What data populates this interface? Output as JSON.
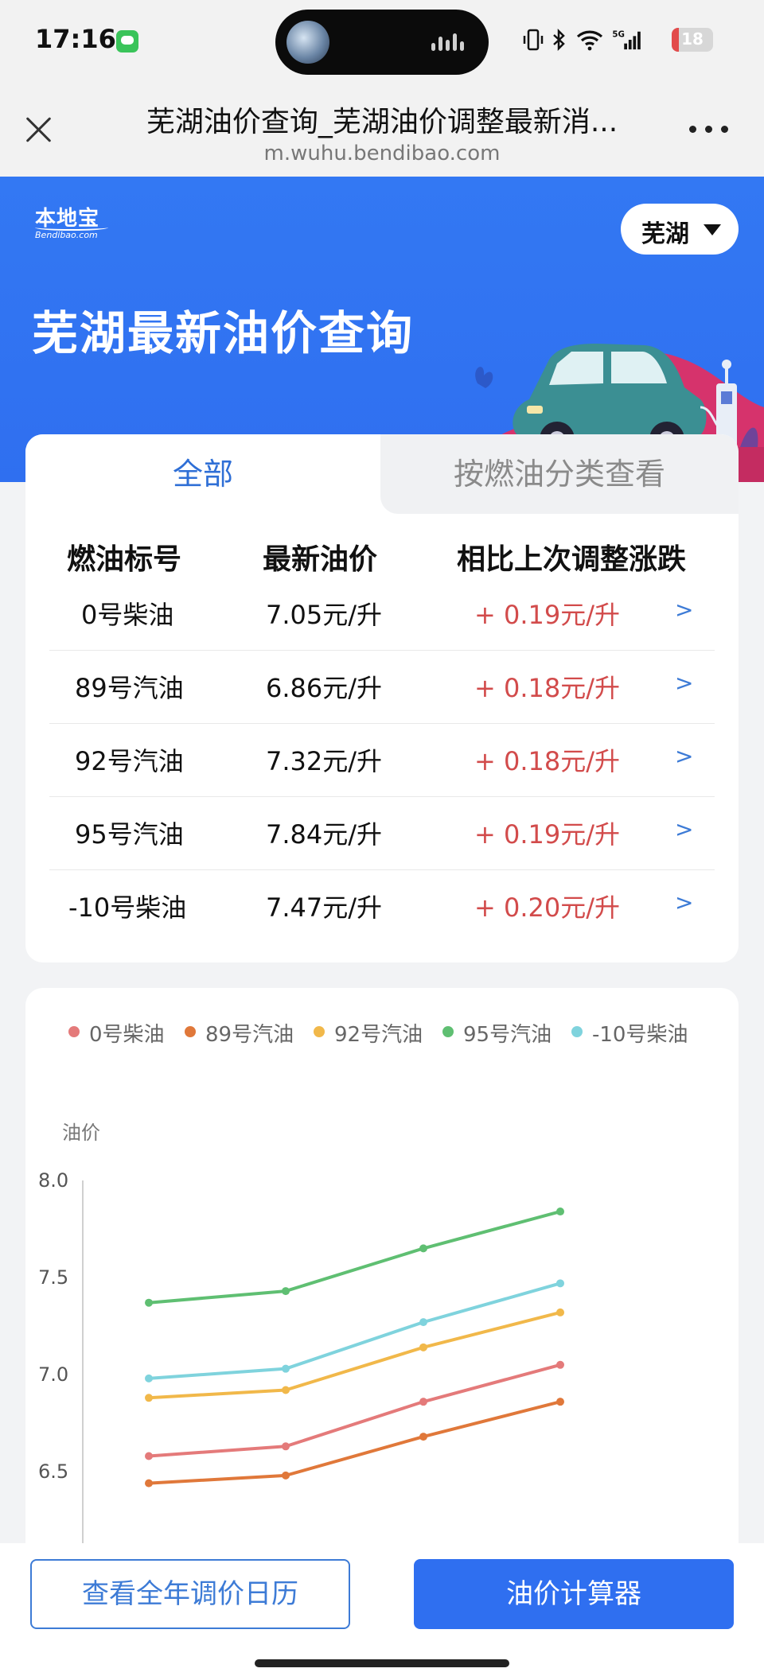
{
  "status_bar": {
    "time": "17:16",
    "battery": "18",
    "battery_level": 0.18,
    "icons": [
      "message-icon",
      "vibrate-icon",
      "bluetooth-icon",
      "wifi-icon",
      "5g-signal-icon",
      "battery-icon"
    ]
  },
  "browser": {
    "title": "芜湖油价查询_芜湖油价调整最新消...",
    "url": "m.wuhu.bendibao.com"
  },
  "hero": {
    "logo_text": "本地宝",
    "logo_sub": "Bendibao.com",
    "city": "芜湖",
    "title": "芜湖最新油价查询"
  },
  "tabs": [
    {
      "label": "全部",
      "active": true
    },
    {
      "label": "按燃油分类查看",
      "active": false
    }
  ],
  "table": {
    "headers": [
      "燃油标号",
      "最新油价",
      "相比上次调整涨跌"
    ],
    "rows": [
      {
        "fuel": "0号柴油",
        "price": "7.05元/升",
        "change": "+ 0.19元/升",
        "arrow": ">"
      },
      {
        "fuel": "89号汽油",
        "price": "6.86元/升",
        "change": "+ 0.18元/升",
        "arrow": ">"
      },
      {
        "fuel": "92号汽油",
        "price": "7.32元/升",
        "change": "+ 0.18元/升",
        "arrow": ">"
      },
      {
        "fuel": "95号汽油",
        "price": "7.84元/升",
        "change": "+ 0.19元/升",
        "arrow": ">"
      },
      {
        "fuel": "-10号柴油",
        "price": "7.47元/升",
        "change": "+ 0.20元/升",
        "arrow": ">"
      }
    ]
  },
  "chart_data": {
    "type": "line",
    "ylabel": "油价",
    "yticks": [
      "8.0",
      "7.5",
      "7.0",
      "6.5"
    ],
    "ylim": [
      6.2,
      8.0
    ],
    "x": [
      1,
      2,
      3,
      4
    ],
    "grid": false,
    "legend_position": "top-left",
    "series": [
      {
        "name": "0号柴油",
        "color": "#e47a7a",
        "values": [
          6.58,
          6.63,
          6.86,
          7.05
        ]
      },
      {
        "name": "89号汽油",
        "color": "#e0783a",
        "values": [
          6.44,
          6.48,
          6.68,
          6.86
        ]
      },
      {
        "name": "92号汽油",
        "color": "#f1b84a",
        "values": [
          6.88,
          6.92,
          7.14,
          7.32
        ]
      },
      {
        "name": "95号汽油",
        "color": "#5fbf72",
        "values": [
          7.37,
          7.43,
          7.65,
          7.84
        ]
      },
      {
        "name": "-10号柴油",
        "color": "#7fd3dd",
        "values": [
          6.98,
          7.03,
          7.27,
          7.47
        ]
      }
    ]
  },
  "bottom": {
    "calendar_button": "查看全年调价日历",
    "calculator_button": "油价计算器"
  },
  "colors": {
    "brand_blue": "#2f6ff0",
    "link_blue": "#3d7bd6",
    "rise_red": "#d24b4b"
  }
}
